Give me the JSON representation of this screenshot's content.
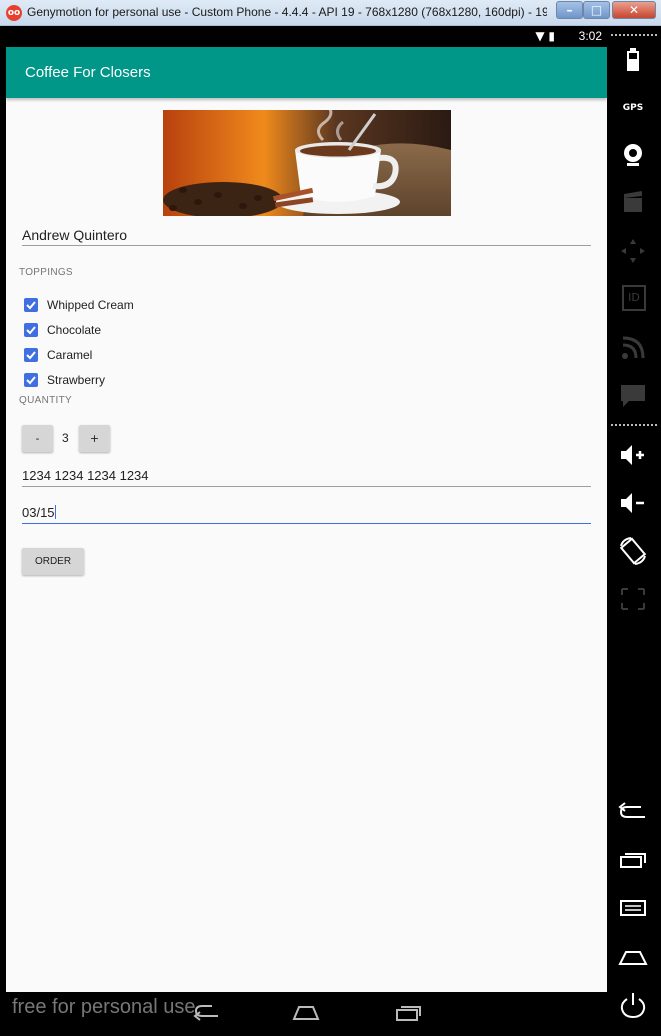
{
  "window": {
    "title": "Genymotion for personal use - Custom Phone - 4.4.4 - API 19 - 768x1280 (768x1280, 160dpi) - 19...",
    "minimize_label": "–",
    "maximize_label": "□",
    "close_label": "✕",
    "app_icon_label": "oo"
  },
  "statusbar": {
    "time": "3:02",
    "icons_label": "▼ ▮"
  },
  "app": {
    "title": "Coffee For Closers"
  },
  "form": {
    "name_value": "Andrew Quintero",
    "toppings_header": "TOPPINGS",
    "toppings": [
      {
        "label": "Whipped Cream",
        "checked": true
      },
      {
        "label": "Chocolate",
        "checked": true
      },
      {
        "label": "Caramel",
        "checked": true
      },
      {
        "label": "Strawberry",
        "checked": true
      }
    ],
    "quantity_header": "QUANTITY",
    "decrement_label": "-",
    "increment_label": "+",
    "quantity": "3",
    "card_number": "1234 1234 1234 1234",
    "expiry": "03/15",
    "order_label": "ORDER"
  },
  "navbar": {
    "watermark": "free for personal use"
  },
  "sidebar": {
    "items": [
      "battery-icon",
      "gps-icon",
      "webcam-icon",
      "media-icon",
      "dpad-icon",
      "id-icon",
      "network-icon",
      "sms-icon",
      "volume-up-icon",
      "volume-down-icon",
      "rotate-icon",
      "resize-icon",
      "back-icon",
      "recent-apps-icon",
      "menu-icon",
      "home-icon",
      "power-icon"
    ],
    "gps_label": "GPS",
    "id_label": "ID"
  },
  "colors": {
    "primary": "#009688",
    "accent": "#3f6fe0"
  }
}
